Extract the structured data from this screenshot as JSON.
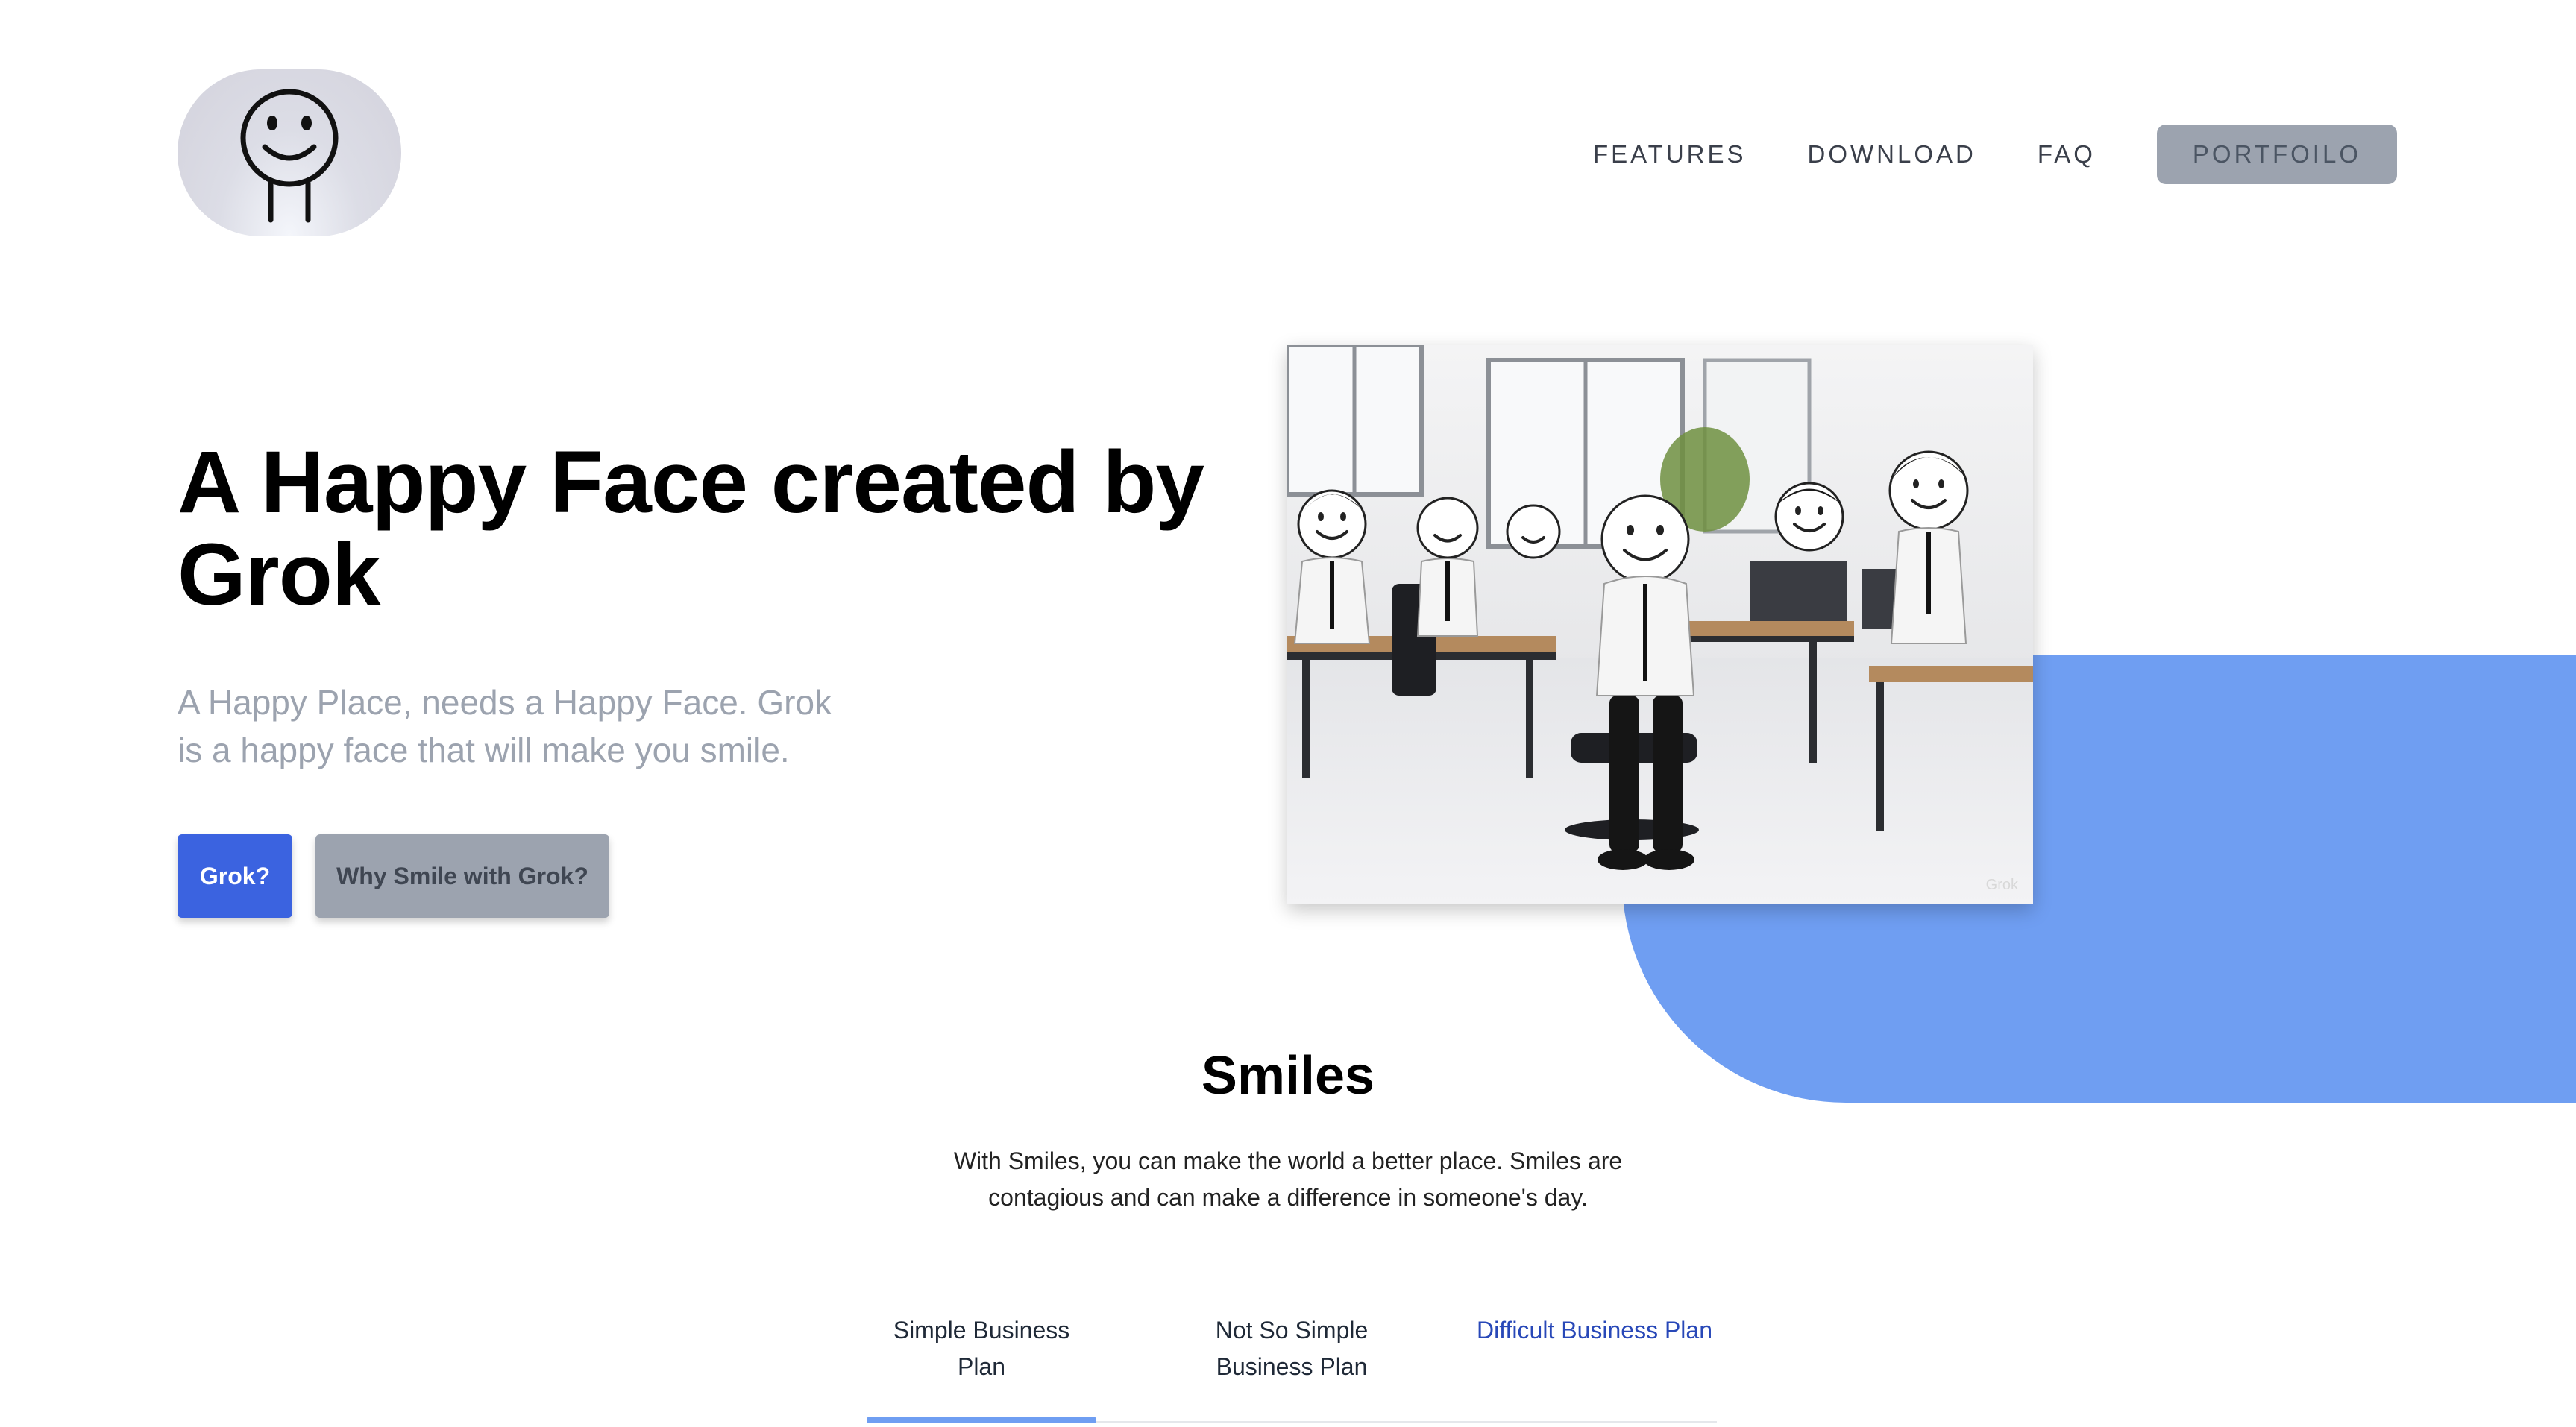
{
  "header": {
    "nav": [
      {
        "label": "FEATURES"
      },
      {
        "label": "DOWNLOAD"
      },
      {
        "label": "FAQ"
      }
    ],
    "portfolio_label": "PORTFOILO"
  },
  "hero": {
    "title": "A Happy Face created by Grok",
    "subtitle": "A Happy Place, needs a Happy Face. Grok is a happy face that will make you smile.",
    "primary_button": "Grok?",
    "secondary_button": "Why Smile with Grok?",
    "image_watermark": "Grok"
  },
  "smiles": {
    "title": "Smiles",
    "description": "With Smiles, you can make the world a better place. Smiles are contagious and can make a difference in someone's day."
  },
  "tabs": [
    {
      "label": "Simple Business Plan"
    },
    {
      "label": "Not So Simple Business Plan"
    },
    {
      "label": "Difficult Business Plan"
    }
  ],
  "colors": {
    "accent_blue": "#6f9ef2",
    "primary_button": "#3b63e0",
    "secondary_button": "#9ca3af",
    "active_tab_text": "#2848b8"
  },
  "icons": {
    "logo": "smiley-face-icon"
  }
}
